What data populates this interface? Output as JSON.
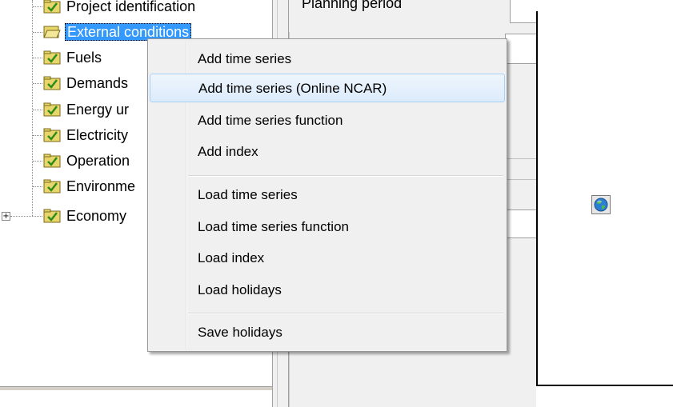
{
  "tree": {
    "items": [
      {
        "label": "Project identification",
        "selected": false
      },
      {
        "label": "External conditions",
        "selected": true
      },
      {
        "label": "Fuels",
        "selected": false
      },
      {
        "label": "Demands",
        "selected": false
      },
      {
        "label": "Energy ur",
        "selected": false
      },
      {
        "label": "Electricity",
        "selected": false
      },
      {
        "label": "Operation",
        "selected": false
      },
      {
        "label": "Environme",
        "selected": false
      },
      {
        "label": "Economy",
        "selected": false
      }
    ],
    "expander_symbol": "+"
  },
  "form": {
    "planning_label": "Planning period"
  },
  "context_menu": {
    "items": [
      {
        "label": "Add time series"
      },
      {
        "label": "Add time series (Online NCAR)",
        "hover": true
      },
      {
        "label": "Add time series function"
      },
      {
        "label": "Add index"
      },
      {
        "label": "Load time series"
      },
      {
        "label": "Load time series function"
      },
      {
        "label": "Load index"
      },
      {
        "label": "Load holidays"
      },
      {
        "label": "Save holidays"
      }
    ]
  },
  "icons": {
    "folder_closed": "folder-check-icon",
    "folder_open": "folder-open-icon",
    "globe": "globe-icon"
  },
  "colors": {
    "selection": "#3399ff",
    "folder": "#e8d66a",
    "check": "#2e8b1e",
    "menu_hover_border": "#a8d2f5"
  }
}
